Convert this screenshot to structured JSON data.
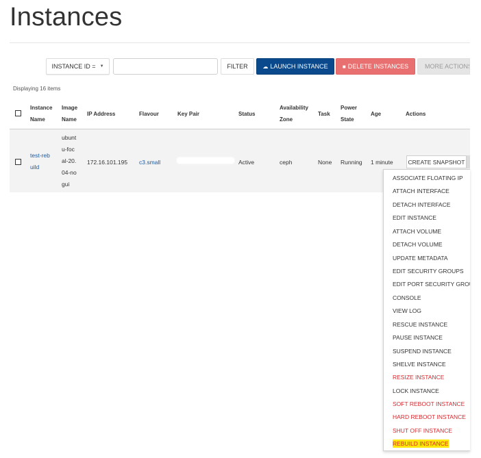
{
  "page": {
    "title": "Instances"
  },
  "toolbar": {
    "filter_field": "INSTANCE ID =",
    "filter_value": "",
    "filter_label": "FILTER",
    "launch_label": "LAUNCH INSTANCE",
    "delete_label": "DELETE INSTANCES",
    "more_label": "MORE ACTIONS"
  },
  "summary": {
    "count_text": "Displaying 16 items"
  },
  "table": {
    "headers": {
      "name": [
        "Instance",
        "Name"
      ],
      "image": [
        "Image",
        "Name"
      ],
      "ip": "IP Address",
      "flavour": "Flavour",
      "keypair": "Key Pair",
      "status": "Status",
      "zone": [
        "Availability",
        "Zone"
      ],
      "task": "Task",
      "power": [
        "Power",
        "State"
      ],
      "age": "Age",
      "actions": "Actions"
    },
    "row": {
      "name_lines": [
        "test-reb",
        "uild"
      ],
      "image_lines": [
        "ubunt",
        "u-foc",
        "al-20.",
        "04-no",
        "gui"
      ],
      "ip": "172.16.101.195",
      "flavour": "c3.small",
      "keypair": "",
      "status": "Active",
      "zone": "ceph",
      "task": "None",
      "power": "Running",
      "age": "1 minute",
      "action_label": "CREATE SNAPSHOT"
    }
  },
  "menu": {
    "items": [
      {
        "label": "ASSOCIATE FLOATING IP",
        "style": "normal"
      },
      {
        "label": "ATTACH INTERFACE",
        "style": "normal"
      },
      {
        "label": "DETACH INTERFACE",
        "style": "normal"
      },
      {
        "label": "EDIT INSTANCE",
        "style": "normal"
      },
      {
        "label": "ATTACH VOLUME",
        "style": "normal"
      },
      {
        "label": "DETACH VOLUME",
        "style": "normal"
      },
      {
        "label": "UPDATE METADATA",
        "style": "normal"
      },
      {
        "label": "EDIT SECURITY GROUPS",
        "style": "normal"
      },
      {
        "label": "EDIT PORT SECURITY GROUPS",
        "style": "normal"
      },
      {
        "label": "CONSOLE",
        "style": "normal"
      },
      {
        "label": "VIEW LOG",
        "style": "normal"
      },
      {
        "label": "RESCUE INSTANCE",
        "style": "normal"
      },
      {
        "label": "PAUSE INSTANCE",
        "style": "normal"
      },
      {
        "label": "SUSPEND INSTANCE",
        "style": "normal"
      },
      {
        "label": "SHELVE INSTANCE",
        "style": "normal"
      },
      {
        "label": "RESIZE INSTANCE",
        "style": "danger"
      },
      {
        "label": "LOCK INSTANCE",
        "style": "normal"
      },
      {
        "label": "SOFT REBOOT INSTANCE",
        "style": "danger"
      },
      {
        "label": "HARD REBOOT INSTANCE",
        "style": "danger"
      },
      {
        "label": "SHUT OFF INSTANCE",
        "style": "danger"
      },
      {
        "label": "REBUILD INSTANCE",
        "style": "highlight"
      }
    ]
  },
  "colors": {
    "primary": "#0a4a8c",
    "danger": "#e87070",
    "danger_text": "#d9262c",
    "highlight": "#ffe60d",
    "link": "#1e5aa0"
  }
}
